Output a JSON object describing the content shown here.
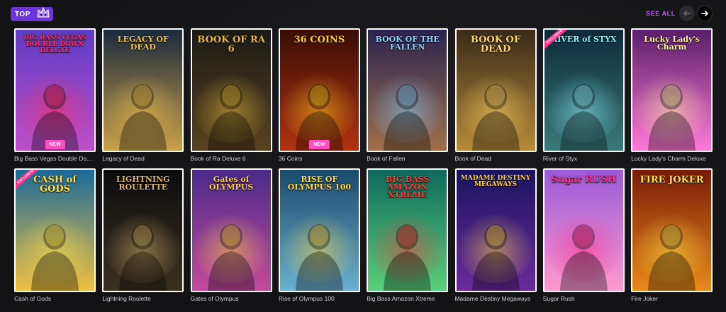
{
  "header": {
    "badge_label": "TOP",
    "see_all_label": "SEE ALL"
  },
  "colors": {
    "accent": "#6b35d8",
    "see_all": "#c25cff",
    "new_badge": "#ff4fc1",
    "card_border": "#ffffff"
  },
  "games": [
    {
      "name": "Big Bass Vegas Double Down...",
      "art_title": "BIG BASS VEGAS DOUBLE DOWN DELUXE",
      "badge": "NEW",
      "bg": [
        "#5d3cc4",
        "#c04fc8"
      ],
      "accent": "#ff2e5a",
      "icon": "fisherman-icon"
    },
    {
      "name": "Legacy of Dead",
      "art_title": "LEGACY OF DEAD",
      "badge": "",
      "bg": [
        "#1b2a3d",
        "#c9a04a"
      ],
      "accent": "#f2c14e",
      "icon": "scarab-icon"
    },
    {
      "name": "Book of Ra Deluxe 6",
      "art_title": "BOOK OF RA 6",
      "badge": "",
      "bg": [
        "#1a1a16",
        "#5a4220"
      ],
      "accent": "#e8b93c",
      "icon": "explorer-icon"
    },
    {
      "name": "36 Coins",
      "art_title": "36 COINS",
      "badge": "NEW",
      "bg": [
        "#3a0d05",
        "#b33210"
      ],
      "accent": "#ffcc22",
      "icon": "coin-icon"
    },
    {
      "name": "Book of Fallen",
      "art_title": "BOOK OF THE FALLEN",
      "badge": "",
      "bg": [
        "#2b2350",
        "#a0704a"
      ],
      "accent": "#8ad0ff",
      "icon": "adventurer-icon"
    },
    {
      "name": "Book of Dead",
      "art_title": "BOOK OF DEAD",
      "badge": "",
      "bg": [
        "#3a2a18",
        "#b58a3a"
      ],
      "accent": "#ffd56a",
      "icon": "pharaoh-icon"
    },
    {
      "name": "River of Styx",
      "art_title": "RIVER of STYX",
      "badge": "EXCLUSIVE",
      "bg": [
        "#0d2a3a",
        "#3a7a7a"
      ],
      "accent": "#8ef0ff",
      "icon": "reaper-icon"
    },
    {
      "name": "Lucky Lady's Charm Deluxe",
      "art_title": "Lucky Lady's Charm",
      "badge": "",
      "bg": [
        "#5a1e6a",
        "#ff7ad8"
      ],
      "accent": "#fff2a0",
      "icon": "crystal-ball-icon"
    },
    {
      "name": "Cash of Gods",
      "art_title": "CASH of GODS",
      "badge": "EXCLUSIVE",
      "bg": [
        "#1a6a9a",
        "#f0c040"
      ],
      "accent": "#ffe04a",
      "icon": "zeus-icon"
    },
    {
      "name": "Lightning Roulette",
      "art_title": "LIGHTNING ROULETTE",
      "badge": "",
      "bg": [
        "#0c0c0e",
        "#3a3020"
      ],
      "accent": "#d9b56a",
      "icon": "dealer-icon"
    },
    {
      "name": "Gates of Olympus",
      "art_title": "Gates of OLYMPUS",
      "badge": "",
      "bg": [
        "#4a2a8a",
        "#c44a9a"
      ],
      "accent": "#ffcf4a",
      "icon": "zeus-icon"
    },
    {
      "name": "Rise of Olympus 100",
      "art_title": "RISE OF OLYMPUS 100",
      "badge": "",
      "bg": [
        "#1a4a6a",
        "#6ab0d0"
      ],
      "accent": "#ffd84a",
      "icon": "zeus-icon"
    },
    {
      "name": "Big Bass Amazon Xtreme",
      "art_title": "BIG BASS AMAZON XTREME",
      "badge": "",
      "bg": [
        "#0e6a5a",
        "#5ad07a"
      ],
      "accent": "#ff3a3a",
      "icon": "fisherman-icon"
    },
    {
      "name": "Madame Destiny Megaways",
      "art_title": "MADAME DESTINY MEGAWAYS",
      "badge": "",
      "bg": [
        "#1a1460",
        "#6a2a9a"
      ],
      "accent": "#ffd04a",
      "icon": "fortune-teller-icon"
    },
    {
      "name": "Sugar Rush",
      "art_title": "Sugar RUSH",
      "badge": "",
      "bg": [
        "#9a5ad8",
        "#ff9ad0"
      ],
      "accent": "#ff2e8a",
      "icon": "gummy-bear-icon"
    },
    {
      "name": "Fire Joker",
      "art_title": "FIRE JOKER",
      "badge": "",
      "bg": [
        "#7a1a08",
        "#e88a1a"
      ],
      "accent": "#ffe04a",
      "icon": "wheel-icon"
    }
  ]
}
